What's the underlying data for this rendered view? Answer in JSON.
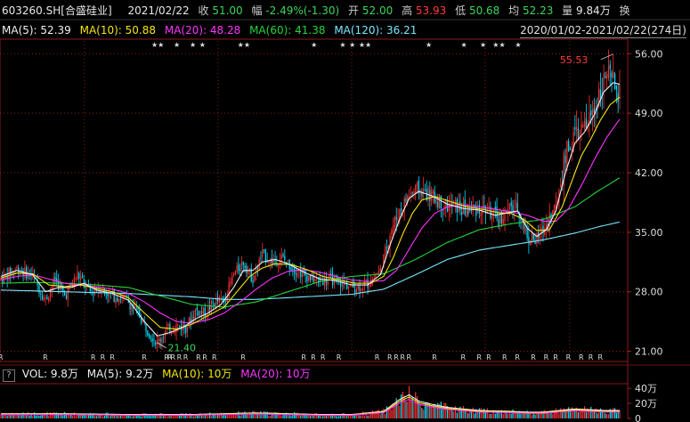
{
  "quote": {
    "code": "603260.SH[合盛硅业]",
    "date": "2021/02/22",
    "close_label": "收",
    "close": "51.00",
    "change_label": "幅",
    "change": "-2.49%(-1.30)",
    "open_label": "开",
    "open": "52.00",
    "high_label": "高",
    "high": "53.93",
    "low_label": "低",
    "low": "50.68",
    "avg_label": "均",
    "avg": "52.23",
    "vol_label": "量",
    "vol": "9.84万",
    "swap_label": "换"
  },
  "ma_legend": [
    {
      "label": "MA(5): 52.39",
      "color": "#f0f0f0"
    },
    {
      "label": "MA(10): 50.88",
      "color": "#f5e50a"
    },
    {
      "label": "MA(20): 48.28",
      "color": "#ff33ff"
    },
    {
      "label": "MA(60): 41.38",
      "color": "#25d43a"
    },
    {
      "label": "MA(120): 36.21",
      "color": "#77e8ff"
    }
  ],
  "date_range": "2020/01/02-2021/02/22(274日)",
  "vol_legend": {
    "qmark": "?",
    "items": [
      {
        "label": "VOL: 9.8万",
        "color": "#f0f0f0"
      },
      {
        "label": "MA(5): 9.2万",
        "color": "#f0f0f0"
      },
      {
        "label": "MA(10): 10万",
        "color": "#f5e50a"
      },
      {
        "label": "MA(20): 10万",
        "color": "#ff33ff"
      }
    ]
  },
  "chart_data": {
    "type": "candlestick",
    "y_ticks": [
      "56.00",
      "49.00",
      "42.00",
      "35.00",
      "28.00",
      "21.00"
    ],
    "ylim": [
      19.8,
      57.5
    ],
    "vol_ticks": [
      "40万",
      "20万",
      "0"
    ],
    "vol_ylim": [
      0,
      45
    ],
    "high_annotation": "55.53",
    "low_annotation": "21.40",
    "colors": {
      "up": "#ff3030",
      "down": "#00e0ff",
      "grid": "#8a1a1a"
    },
    "price_keyframes": [
      [
        0,
        29.5
      ],
      [
        10,
        30.8
      ],
      [
        20,
        29.8
      ],
      [
        28,
        27.0
      ],
      [
        34,
        29.5
      ],
      [
        40,
        27.5
      ],
      [
        48,
        30.0
      ],
      [
        56,
        28.0
      ],
      [
        62,
        28.5
      ],
      [
        70,
        27.5
      ],
      [
        78,
        27.2
      ],
      [
        86,
        25.5
      ],
      [
        92,
        23.5
      ],
      [
        98,
        22.0
      ],
      [
        104,
        23.5
      ],
      [
        110,
        24.0
      ],
      [
        116,
        23.8
      ],
      [
        122,
        25.8
      ],
      [
        128,
        25.5
      ],
      [
        134,
        26.8
      ],
      [
        140,
        27.0
      ],
      [
        146,
        30.0
      ],
      [
        152,
        31.5
      ],
      [
        158,
        29.5
      ],
      [
        164,
        32.5
      ],
      [
        170,
        31.5
      ],
      [
        176,
        32.0
      ],
      [
        182,
        31.0
      ],
      [
        190,
        30.0
      ],
      [
        198,
        29.3
      ],
      [
        206,
        29.5
      ],
      [
        214,
        29.0
      ],
      [
        222,
        28.5
      ],
      [
        230,
        29.0
      ],
      [
        238,
        30.5
      ],
      [
        244,
        35.0
      ],
      [
        250,
        37.5
      ],
      [
        256,
        39.5
      ],
      [
        262,
        40.0
      ],
      [
        268,
        39.5
      ],
      [
        274,
        38.8
      ],
      [
        280,
        38.0
      ],
      [
        286,
        38.0
      ],
      [
        292,
        37.5
      ],
      [
        298,
        37.8
      ],
      [
        306,
        37.5
      ],
      [
        312,
        36.5
      ],
      [
        318,
        37.5
      ],
      [
        324,
        38.0
      ],
      [
        330,
        34.5
      ],
      [
        336,
        34.0
      ],
      [
        342,
        36.0
      ],
      [
        348,
        38.0
      ],
      [
        354,
        44.0
      ],
      [
        360,
        46.5
      ],
      [
        366,
        47.0
      ],
      [
        372,
        49.5
      ],
      [
        376,
        52.0
      ],
      [
        380,
        53.5
      ],
      [
        384,
        52.5
      ],
      [
        388,
        51.0
      ]
    ],
    "ma5_keyframes": [
      [
        0,
        29.8
      ],
      [
        10,
        30.5
      ],
      [
        20,
        30.0
      ],
      [
        28,
        28.0
      ],
      [
        36,
        28.5
      ],
      [
        44,
        28.5
      ],
      [
        52,
        29.0
      ],
      [
        60,
        28.2
      ],
      [
        70,
        27.8
      ],
      [
        80,
        27.0
      ],
      [
        90,
        24.5
      ],
      [
        98,
        22.8
      ],
      [
        106,
        23.2
      ],
      [
        114,
        23.8
      ],
      [
        122,
        24.8
      ],
      [
        130,
        25.5
      ],
      [
        138,
        26.5
      ],
      [
        146,
        28.5
      ],
      [
        152,
        30.5
      ],
      [
        158,
        30.5
      ],
      [
        164,
        31.5
      ],
      [
        172,
        31.8
      ],
      [
        180,
        31.3
      ],
      [
        190,
        30.3
      ],
      [
        200,
        29.5
      ],
      [
        210,
        29.3
      ],
      [
        220,
        28.8
      ],
      [
        230,
        28.8
      ],
      [
        238,
        30.0
      ],
      [
        244,
        33.5
      ],
      [
        250,
        36.5
      ],
      [
        256,
        39.0
      ],
      [
        262,
        39.8
      ],
      [
        270,
        39.3
      ],
      [
        280,
        38.3
      ],
      [
        290,
        37.8
      ],
      [
        300,
        37.6
      ],
      [
        310,
        37.0
      ],
      [
        318,
        37.3
      ],
      [
        324,
        37.5
      ],
      [
        330,
        35.5
      ],
      [
        336,
        34.5
      ],
      [
        342,
        35.3
      ],
      [
        348,
        37.5
      ],
      [
        354,
        42.0
      ],
      [
        360,
        45.5
      ],
      [
        366,
        46.8
      ],
      [
        372,
        48.8
      ],
      [
        378,
        51.5
      ],
      [
        384,
        52.6
      ],
      [
        388,
        52.4
      ]
    ],
    "ma10_keyframes": [
      [
        0,
        29.6
      ],
      [
        10,
        30.2
      ],
      [
        20,
        30.1
      ],
      [
        30,
        28.8
      ],
      [
        40,
        28.6
      ],
      [
        50,
        28.8
      ],
      [
        60,
        28.4
      ],
      [
        70,
        28.0
      ],
      [
        80,
        27.3
      ],
      [
        90,
        25.5
      ],
      [
        100,
        23.8
      ],
      [
        110,
        23.6
      ],
      [
        120,
        24.2
      ],
      [
        130,
        25.2
      ],
      [
        140,
        26.2
      ],
      [
        148,
        28.0
      ],
      [
        156,
        29.8
      ],
      [
        164,
        30.8
      ],
      [
        172,
        31.3
      ],
      [
        182,
        31.2
      ],
      [
        192,
        30.6
      ],
      [
        202,
        29.8
      ],
      [
        212,
        29.4
      ],
      [
        222,
        29.0
      ],
      [
        232,
        29.0
      ],
      [
        240,
        29.8
      ],
      [
        246,
        32.0
      ],
      [
        252,
        34.8
      ],
      [
        258,
        37.2
      ],
      [
        264,
        38.8
      ],
      [
        272,
        39.2
      ],
      [
        282,
        38.6
      ],
      [
        292,
        38.0
      ],
      [
        302,
        37.7
      ],
      [
        312,
        37.3
      ],
      [
        320,
        37.2
      ],
      [
        328,
        36.5
      ],
      [
        336,
        35.2
      ],
      [
        344,
        35.3
      ],
      [
        352,
        38.0
      ],
      [
        358,
        41.0
      ],
      [
        364,
        44.0
      ],
      [
        370,
        46.0
      ],
      [
        376,
        48.2
      ],
      [
        382,
        50.0
      ],
      [
        388,
        50.9
      ]
    ],
    "ma20_keyframes": [
      [
        0,
        29.4
      ],
      [
        10,
        29.8
      ],
      [
        20,
        30.0
      ],
      [
        30,
        29.5
      ],
      [
        40,
        29.0
      ],
      [
        50,
        28.8
      ],
      [
        60,
        28.6
      ],
      [
        70,
        28.3
      ],
      [
        80,
        27.8
      ],
      [
        90,
        26.8
      ],
      [
        100,
        25.5
      ],
      [
        110,
        24.5
      ],
      [
        120,
        24.3
      ],
      [
        130,
        24.7
      ],
      [
        140,
        25.5
      ],
      [
        150,
        26.8
      ],
      [
        160,
        28.3
      ],
      [
        170,
        29.6
      ],
      [
        180,
        30.4
      ],
      [
        190,
        30.6
      ],
      [
        200,
        30.3
      ],
      [
        210,
        29.8
      ],
      [
        220,
        29.4
      ],
      [
        230,
        29.2
      ],
      [
        240,
        29.3
      ],
      [
        248,
        30.5
      ],
      [
        256,
        33.0
      ],
      [
        264,
        35.5
      ],
      [
        272,
        37.2
      ],
      [
        280,
        38.0
      ],
      [
        290,
        38.2
      ],
      [
        300,
        38.0
      ],
      [
        310,
        37.7
      ],
      [
        320,
        37.4
      ],
      [
        330,
        37.0
      ],
      [
        340,
        36.3
      ],
      [
        348,
        36.3
      ],
      [
        356,
        37.8
      ],
      [
        364,
        40.5
      ],
      [
        372,
        43.5
      ],
      [
        380,
        46.2
      ],
      [
        388,
        48.3
      ]
    ],
    "ma60_keyframes": [
      [
        0,
        29.0
      ],
      [
        20,
        29.1
      ],
      [
        40,
        29.0
      ],
      [
        60,
        28.8
      ],
      [
        80,
        28.5
      ],
      [
        100,
        27.5
      ],
      [
        120,
        26.5
      ],
      [
        140,
        26.2
      ],
      [
        160,
        26.8
      ],
      [
        180,
        28.0
      ],
      [
        200,
        29.2
      ],
      [
        220,
        29.8
      ],
      [
        240,
        30.1
      ],
      [
        260,
        31.8
      ],
      [
        280,
        33.8
      ],
      [
        300,
        35.3
      ],
      [
        320,
        36.0
      ],
      [
        340,
        36.5
      ],
      [
        360,
        38.0
      ],
      [
        374,
        39.8
      ],
      [
        388,
        41.4
      ]
    ],
    "ma120_keyframes": [
      [
        0,
        28.2
      ],
      [
        20,
        28.1
      ],
      [
        40,
        28.0
      ],
      [
        60,
        27.9
      ],
      [
        80,
        27.8
      ],
      [
        100,
        27.6
      ],
      [
        120,
        27.4
      ],
      [
        140,
        27.1
      ],
      [
        160,
        27.1
      ],
      [
        180,
        27.3
      ],
      [
        200,
        27.5
      ],
      [
        220,
        27.7
      ],
      [
        240,
        28.3
      ],
      [
        260,
        30.0
      ],
      [
        280,
        31.8
      ],
      [
        300,
        32.9
      ],
      [
        320,
        33.5
      ],
      [
        340,
        34.1
      ],
      [
        360,
        34.9
      ],
      [
        376,
        35.7
      ],
      [
        388,
        36.2
      ]
    ],
    "vol_keyframes": [
      [
        0,
        6
      ],
      [
        40,
        6
      ],
      [
        80,
        5
      ],
      [
        120,
        5
      ],
      [
        140,
        6
      ],
      [
        160,
        7
      ],
      [
        180,
        6
      ],
      [
        200,
        5
      ],
      [
        220,
        5
      ],
      [
        240,
        9
      ],
      [
        250,
        24
      ],
      [
        256,
        30
      ],
      [
        262,
        22
      ],
      [
        270,
        18
      ],
      [
        280,
        14
      ],
      [
        290,
        12
      ],
      [
        300,
        10
      ],
      [
        320,
        9
      ],
      [
        330,
        8
      ],
      [
        340,
        8
      ],
      [
        350,
        10
      ],
      [
        360,
        12
      ],
      [
        370,
        11
      ],
      [
        380,
        10
      ],
      [
        388,
        10
      ]
    ],
    "r_markers_idx": [
      0,
      28,
      58,
      64,
      70,
      90,
      104,
      106,
      108,
      112,
      116,
      124,
      128,
      134,
      152,
      190,
      196,
      202,
      212,
      236,
      244,
      248,
      252,
      256,
      272,
      290,
      300,
      306,
      316,
      324,
      334,
      342,
      348,
      356,
      364,
      370,
      376
    ],
    "star_markers_idx": [
      96,
      100,
      110,
      120,
      126,
      150,
      154,
      196,
      214,
      220,
      226,
      230,
      268,
      290,
      302,
      310,
      314,
      324
    ]
  }
}
